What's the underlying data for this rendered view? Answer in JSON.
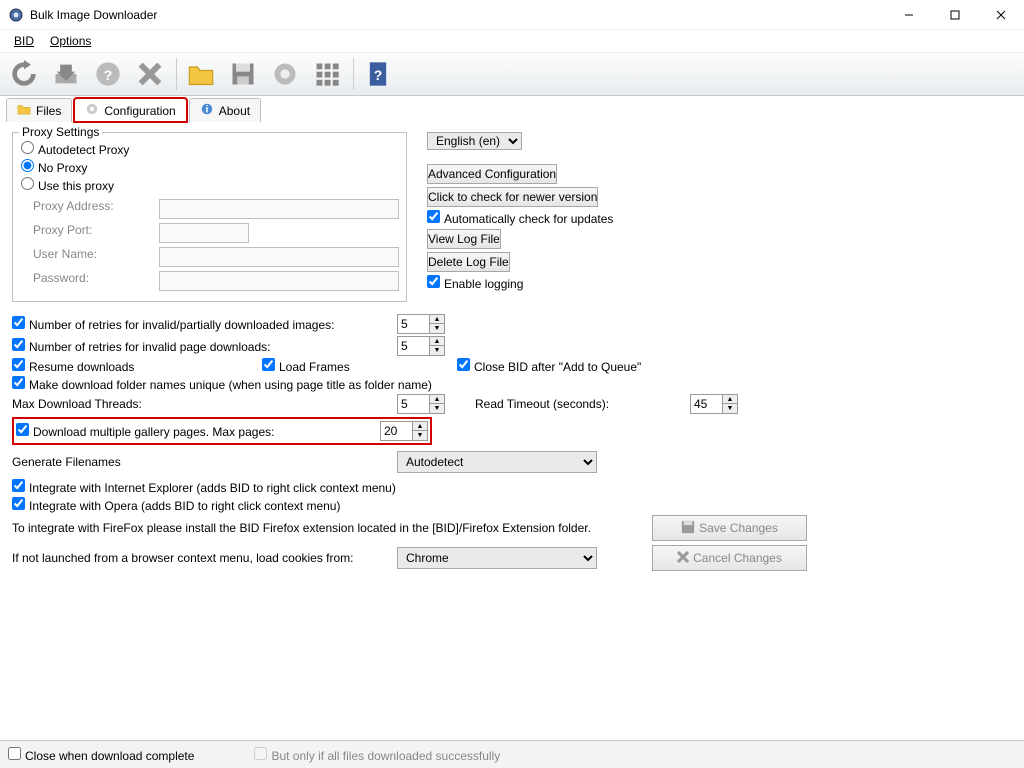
{
  "window": {
    "title": "Bulk Image Downloader"
  },
  "menu": {
    "bid": "BID",
    "options": "Options"
  },
  "tabs": {
    "files": "Files",
    "config": "Configuration",
    "about": "About"
  },
  "proxy": {
    "legend": "Proxy Settings",
    "auto": "Autodetect Proxy",
    "none": "No Proxy",
    "use": "Use this proxy",
    "addr": "Proxy Address:",
    "port": "Proxy Port:",
    "user": "User Name:",
    "pass": "Password:"
  },
  "lang": {
    "value": "English (en)"
  },
  "btns": {
    "advanced": "Advanced Configuration",
    "checkver": "Click to check for newer version",
    "autoupd": "Automatically check for updates",
    "viewlog": "View Log File",
    "dellog": "Delete Log File",
    "elog": "Enable logging"
  },
  "opts": {
    "retries_img": "Number of retries for invalid/partially downloaded images:",
    "retries_img_v": "5",
    "retries_page": "Number of retries for invalid page downloads:",
    "retries_page_v": "5",
    "resume": "Resume downloads",
    "loadframes": "Load Frames",
    "closebid": "Close BID after \"Add to Queue\"",
    "unique": "Make download folder names unique (when using page title as folder name)",
    "threads": "Max Download Threads:",
    "threads_v": "5",
    "readto": "Read Timeout (seconds):",
    "readto_v": "45",
    "multi": "Download multiple gallery pages. Max pages:",
    "multi_v": "20",
    "gen": "Generate Filenames",
    "gen_v": "Autodetect",
    "ie": "Integrate with Internet Explorer (adds BID to right click context menu)",
    "opera": "Integrate with Opera (adds BID to right click context menu)",
    "ff": "To integrate with FireFox please install the BID Firefox extension located in the [BID]/Firefox Extension folder.",
    "cookies": "If not launched from a browser context menu, load cookies from:",
    "cookies_v": "Chrome",
    "save": "Save Changes",
    "cancel": "Cancel Changes"
  },
  "footer": {
    "close": "Close when download complete",
    "butonly": "But only if all files downloaded successfully"
  }
}
